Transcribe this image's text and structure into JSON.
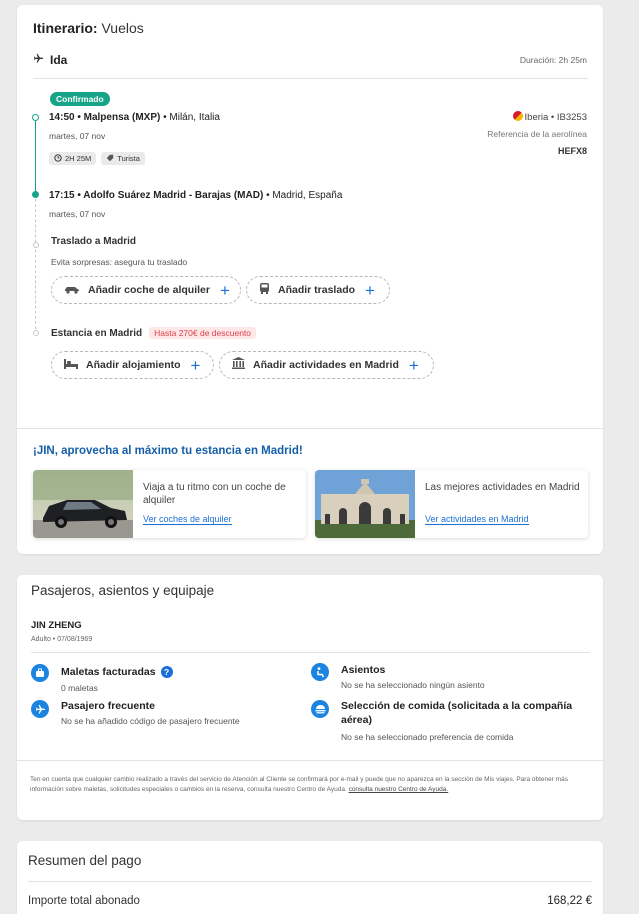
{
  "itinerary": {
    "title_bold": "Itinerario:",
    "title_rest": " Vuelos",
    "direction": "Ida",
    "duration": "Duración: 2h 25m",
    "status": "Confirmado",
    "departure": {
      "time_airport": "14:50 • Malpensa (MXP)",
      "city": " • Milán, Italia",
      "date": "martes, 07 nov"
    },
    "airline": "Iberia • IB3253",
    "ref_label": "Referencia de la aerolínea",
    "ref_code": "HEFX8",
    "flight_duration": "2H 25M",
    "cabin": "Turista",
    "arrival": {
      "time_airport": "17:15 • Adolfo Suárez Madrid - Barajas (MAD)",
      "city": " • Madrid, España",
      "date": "martes, 07 nov"
    },
    "transfer": {
      "title": "Traslado a Madrid",
      "subtitle": "Evita sorpresas: asegura tu traslado",
      "car_button": "Añadir coche de alquiler",
      "transfer_button": "Añadir traslado"
    },
    "stay": {
      "title": "Estancia en Madrid",
      "discount": "Hasta 270€ de descuento",
      "lodging_button": "Añadir alojamiento",
      "activities_button": "Añadir actividades en Madrid"
    },
    "promo": {
      "title": "¡JIN, aprovecha al máximo tu estancia en Madrid!",
      "cards": [
        {
          "text": "Viaja a tu ritmo con un coche de alquiler",
          "link": "Ver coches de alquiler"
        },
        {
          "text": "Las mejores actividades en Madrid",
          "link": "Ver actividades en Madrid"
        }
      ]
    }
  },
  "passengers": {
    "title": "Pasajeros, asientos y equipaje",
    "name": "JIN ZHENG",
    "details": "Adulto • 07/08/1969",
    "features": [
      {
        "title": "Maletas facturadas",
        "sub": "0 maletas",
        "icon": "suitcase-icon"
      },
      {
        "title": "Asientos",
        "sub": "No se ha seleccionado ningún asiento",
        "icon": "seat-icon"
      },
      {
        "title": "Pasajero frecuente",
        "sub": "No se ha añadido código de pasajero frecuente",
        "icon": "plane-icon"
      },
      {
        "title": "Selección de comida (solicitada a la compañía aérea)",
        "sub": "No se ha seleccionado preferencia de comida",
        "icon": "meal-icon"
      }
    ],
    "footnote": "Ten en cuenta que cualquier cambio realizado a través del servicio de Atención al Cliente se confirmará por e-mail y puede que no aparezca en la sección de Mis viajes. Para obtener más información sobre maletas, solicitudes especiales o cambios en la reserva, consulta nuestro Centro de Ayuda.",
    "footnote_link": "consulta nuestro Centro de Ayuda."
  },
  "payment": {
    "title": "Resumen del pago",
    "total_label": "Importe total abonado",
    "total_value": "168,22 €"
  },
  "colors": {
    "accent_green": "#17a589",
    "link_blue": "#1b6fd6",
    "icon_blue": "#1b84e0",
    "promo_red": "#d9434e"
  }
}
